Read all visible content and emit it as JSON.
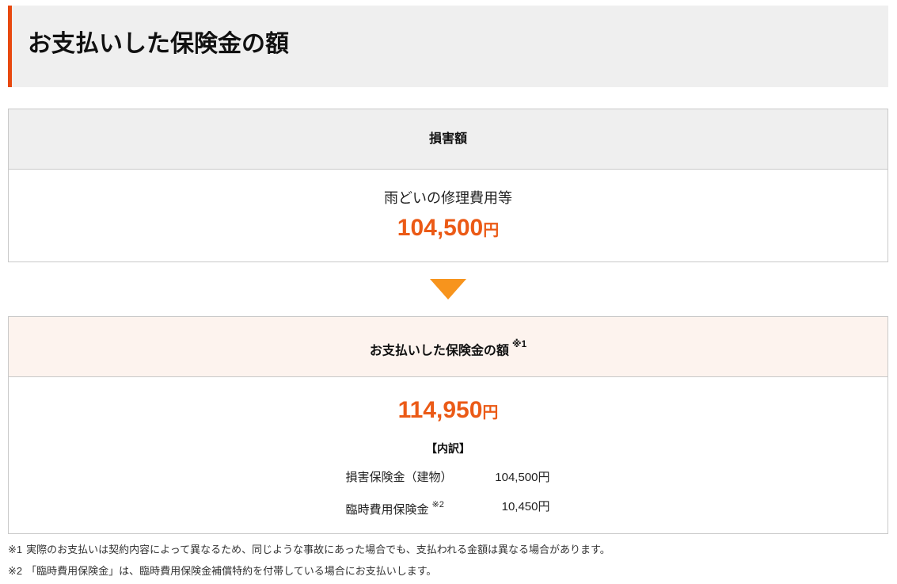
{
  "header": {
    "title": "お支払いした保険金の額"
  },
  "damage": {
    "heading": "損害額",
    "item": "雨どいの修理費用等",
    "amount": "104,500",
    "unit": "円"
  },
  "payment": {
    "heading": "お支払いした保険金の額",
    "heading_note": "※1",
    "amount": "114,950",
    "unit": "円",
    "breakdown_label": "【内訳】",
    "rows": [
      {
        "label": "損害保険金（建物）",
        "value": "104,500円"
      },
      {
        "label": "臨時費用保険金",
        "note": "※2",
        "value": "10,450円"
      }
    ]
  },
  "footnotes": [
    {
      "mark": "※1",
      "text": "実際のお支払いは契約内容によって異なるため、同じような事故にあった場合でも、支払われる金額は異なる場合があります。"
    },
    {
      "mark": "※2",
      "text": "「臨時費用保険金」は、臨時費用保険金補償特約を付帯している場合にお支払いします。"
    }
  ],
  "icons": {
    "arrow": "down-arrow-icon"
  },
  "colors": {
    "accent": "#e8490f",
    "amount": "#eb5a16",
    "arrow": "#f7941d"
  }
}
